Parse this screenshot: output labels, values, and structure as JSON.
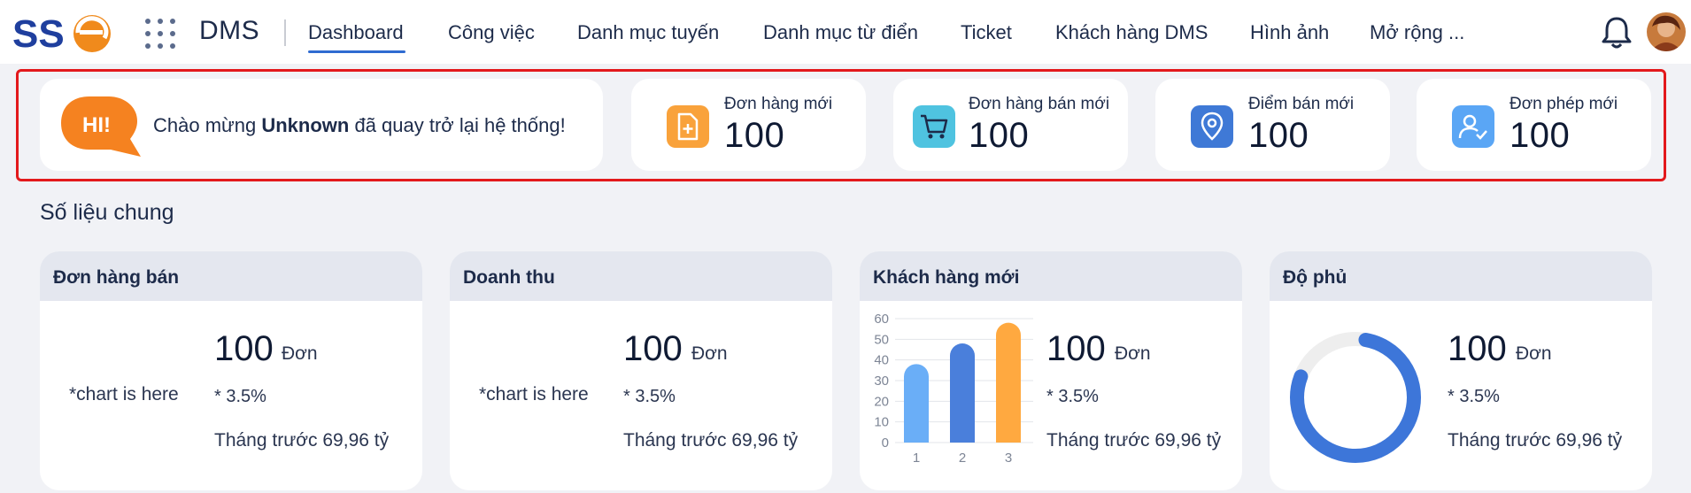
{
  "header": {
    "app_name": "DMS",
    "logo_alt": "SSE logo",
    "nav": [
      {
        "label": "Dashboard",
        "active": true
      },
      {
        "label": "Công việc"
      },
      {
        "label": "Danh mục tuyến"
      },
      {
        "label": "Danh mục từ điển"
      },
      {
        "label": "Ticket"
      },
      {
        "label": "Khách hàng DMS"
      },
      {
        "label": "Hình ảnh"
      },
      {
        "label": "Mở rộng ..."
      }
    ],
    "icons": {
      "menu": "grid-icon",
      "notifications": "bell-icon",
      "profile": "avatar"
    }
  },
  "welcome": {
    "bubble_text": "HI!",
    "prefix": "Chào mừng ",
    "user": "Unknown",
    "suffix": " đã quay trở lại hệ thống!"
  },
  "stats": [
    {
      "label": "Đơn hàng mới",
      "value": "100",
      "icon": "file-plus-icon",
      "color": "#f9a23b"
    },
    {
      "label": "Đơn hàng bán mới",
      "value": "100",
      "icon": "cart-icon",
      "color": "#4fc3e0"
    },
    {
      "label": "Điểm bán mới",
      "value": "100",
      "icon": "location-pin-icon",
      "color": "#3f79d6"
    },
    {
      "label": "Đơn phép mới",
      "value": "100",
      "icon": "user-check-icon",
      "color": "#5aa6f5"
    }
  ],
  "section_title": "Số liệu chung",
  "metrics": [
    {
      "title": "Đơn hàng bán",
      "placeholder": "*chart is here",
      "value": "100",
      "unit": "Đơn",
      "pct": "* 3.5%",
      "prev": "Tháng trước 69,96 tỷ"
    },
    {
      "title": "Doanh thu",
      "placeholder": "*chart is here",
      "value": "100",
      "unit": "Đơn",
      "pct": "* 3.5%",
      "prev": "Tháng trước 69,96 tỷ"
    },
    {
      "title": "Khách hàng mới",
      "value": "100",
      "unit": "Đơn",
      "pct": "* 3.5%",
      "prev": "Tháng trước 69,96 tỷ"
    },
    {
      "title": "Độ phủ",
      "value": "100",
      "unit": "Đơn",
      "pct": "* 3.5%",
      "prev": "Tháng trước 69,96 tỷ"
    }
  ],
  "chart_data": [
    {
      "type": "bar",
      "categories": [
        "1",
        "2",
        "3"
      ],
      "values": [
        38,
        48,
        58
      ],
      "colors": [
        "#6aaef7",
        "#4a7fdb",
        "#ffa940"
      ],
      "ylim": [
        0,
        60
      ],
      "yticks": [
        "0",
        "10",
        "20",
        "30",
        "40",
        "50",
        "60"
      ],
      "grid": true
    },
    {
      "type": "pie",
      "values": [
        0.78,
        0.22
      ],
      "colors": [
        "#3d76d9",
        "#eeeeee"
      ],
      "style": "donut"
    }
  ],
  "colors": {
    "accent": "#2f6bd1",
    "highlight_border": "#e3191c",
    "card_header": "#e4e7ef"
  }
}
